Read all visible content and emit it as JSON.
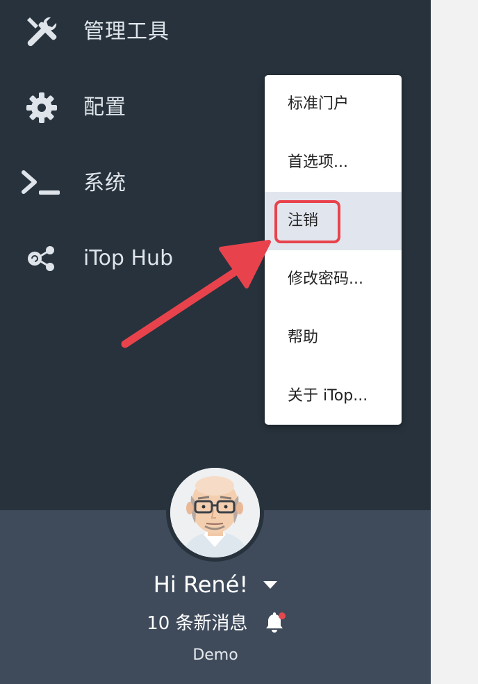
{
  "sidebar": {
    "items": [
      {
        "label": "管理工具",
        "icon": "tools-icon"
      },
      {
        "label": "配置",
        "icon": "gear-icon"
      },
      {
        "label": "系统",
        "icon": "terminal-icon"
      },
      {
        "label": "iTop Hub",
        "icon": "share-icon"
      }
    ]
  },
  "user": {
    "greeting": "Hi René!",
    "messages": "10 条新消息",
    "organization": "Demo"
  },
  "user_menu": {
    "items": [
      {
        "label": "标准门户"
      },
      {
        "label": "首选项..."
      },
      {
        "label": "注销",
        "highlighted": true
      },
      {
        "label": "修改密码..."
      },
      {
        "label": "帮助"
      },
      {
        "label": "关于 iTop..."
      }
    ]
  },
  "colors": {
    "sidebar_bg": "#27323c",
    "user_panel_bg": "#3f4b5b",
    "annotation_red": "#e8434c",
    "notification_dot": "#e5484d"
  }
}
